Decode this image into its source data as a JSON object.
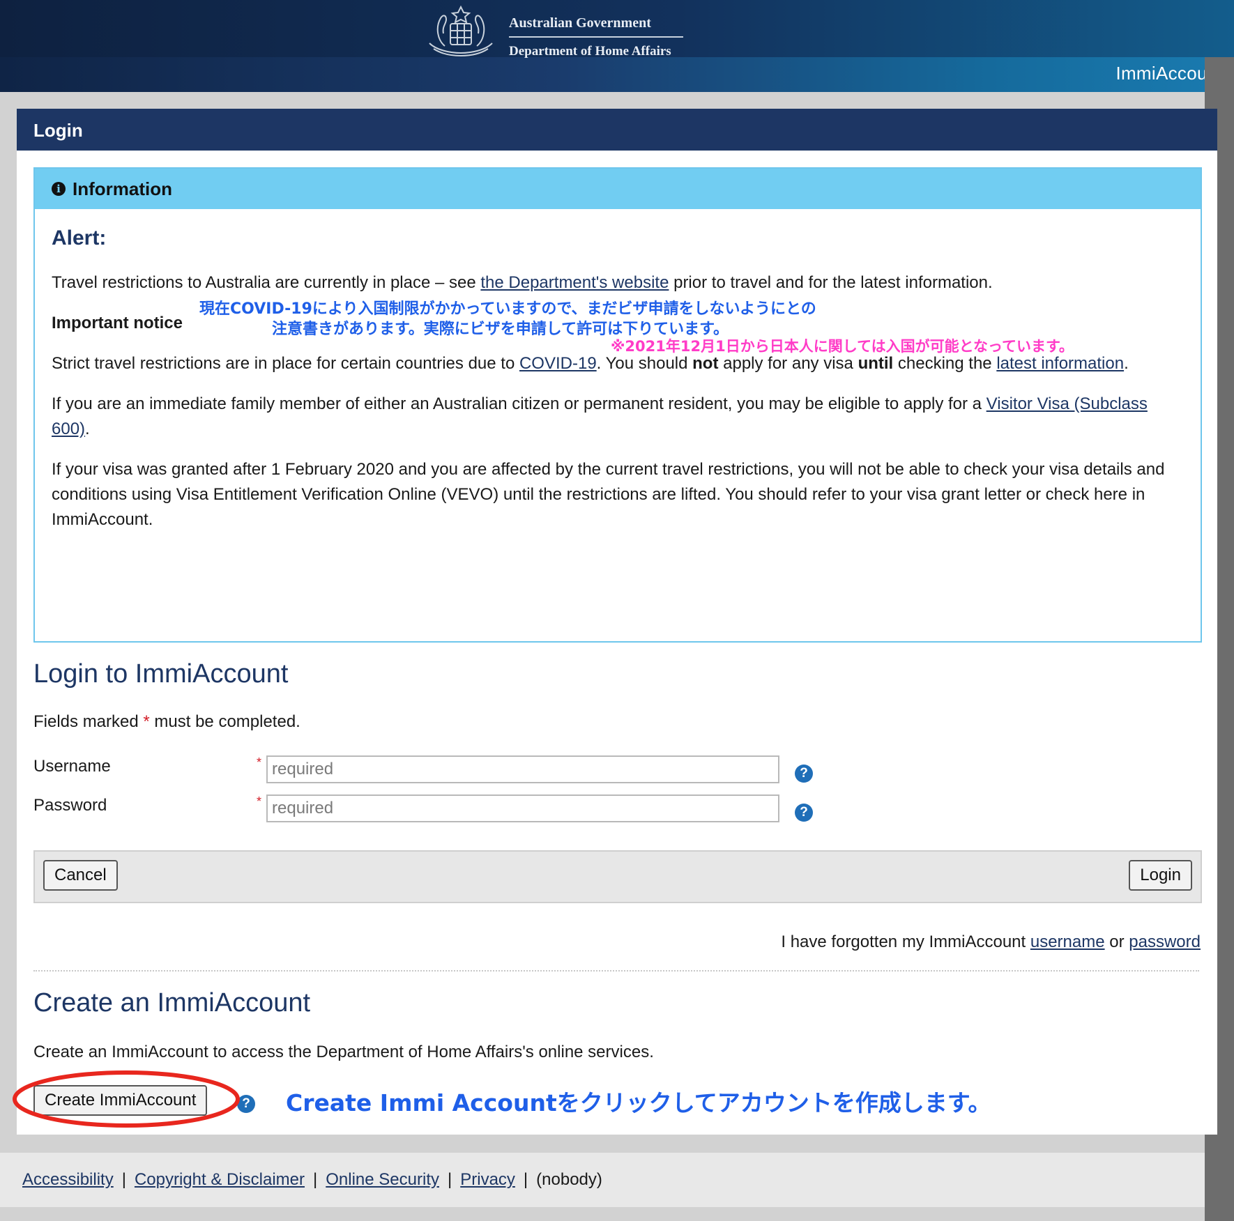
{
  "header": {
    "gov_line1": "Australian Government",
    "gov_line2": "Department of Home Affairs",
    "brand": "ImmiAccount"
  },
  "panel": {
    "title": "Login"
  },
  "info": {
    "heading": "Information",
    "alert_title": "Alert:",
    "p1_pre": "Travel restrictions to Australia are currently in place – see ",
    "p1_link": "the Department's website",
    "p1_post": " prior to travel and for the latest information.",
    "important": "Important notice",
    "p2_pre": "Strict travel restrictions are in place for certain countries due to ",
    "p2_link1": "COVID-19",
    "p2_mid1": ". You should ",
    "p2_bold1": "not",
    "p2_mid2": " apply for any visa ",
    "p2_bold2": "until",
    "p2_mid3": " checking the ",
    "p2_link2": "latest information",
    "p2_post": ".",
    "p3_pre": "If you are an immediate family member of either an Australian citizen or permanent resident, you may be eligible to apply for a ",
    "p3_link": "Visitor Visa (Subclass 600)",
    "p3_post": ".",
    "p4": "If your visa was granted after 1 February 2020 and you are affected by the current travel restrictions, you will not be able to check your visa details and conditions using Visa Entitlement Verification Online (VEVO) until the restrictions are lifted. You should refer to your visa grant letter or check here in ImmiAccount."
  },
  "annotations": {
    "jp_line1": "現在COVID-19により入国制限がかかっていますので、まだビザ申請をしないようにとの",
    "jp_line2": "注意書きがあります。実際にビザを申請して許可は下りています。",
    "jp_pink": "※2021年12月1日から日本人に関しては入国が可能となっています。",
    "jp_create": "Create Immi Accountをクリックしてアカウントを作成します。"
  },
  "login": {
    "title": "Login to ImmiAccount",
    "fields_note_pre": "Fields marked ",
    "fields_note_star": "*",
    "fields_note_post": " must be completed.",
    "username_label": "Username",
    "username_placeholder": "required",
    "password_label": "Password",
    "password_placeholder": "required",
    "star": "*",
    "help": "?",
    "cancel_label": "Cancel",
    "login_label": "Login",
    "forgot_pre": "I have forgotten my ImmiAccount ",
    "forgot_username": "username",
    "forgot_or": " or ",
    "forgot_password": "password"
  },
  "create": {
    "title": "Create an ImmiAccount",
    "desc": "Create an ImmiAccount to access the Department of Home Affairs's online services.",
    "button_label": "Create ImmiAccount",
    "help": "?"
  },
  "footer": {
    "links": [
      "Accessibility",
      "Copyright & Disclaimer",
      "Online Security",
      "Privacy"
    ],
    "sep": "|",
    "user": "(nobody)"
  },
  "colors": {
    "header_navy": "#1d3664",
    "info_blue": "#71cdf2",
    "annotation_blue": "#1f5fe8",
    "annotation_pink": "#ff3cc7",
    "ring_red": "#e8271e"
  },
  "icons": [
    "coat-of-arms-icon",
    "info-icon",
    "help-icon"
  ]
}
